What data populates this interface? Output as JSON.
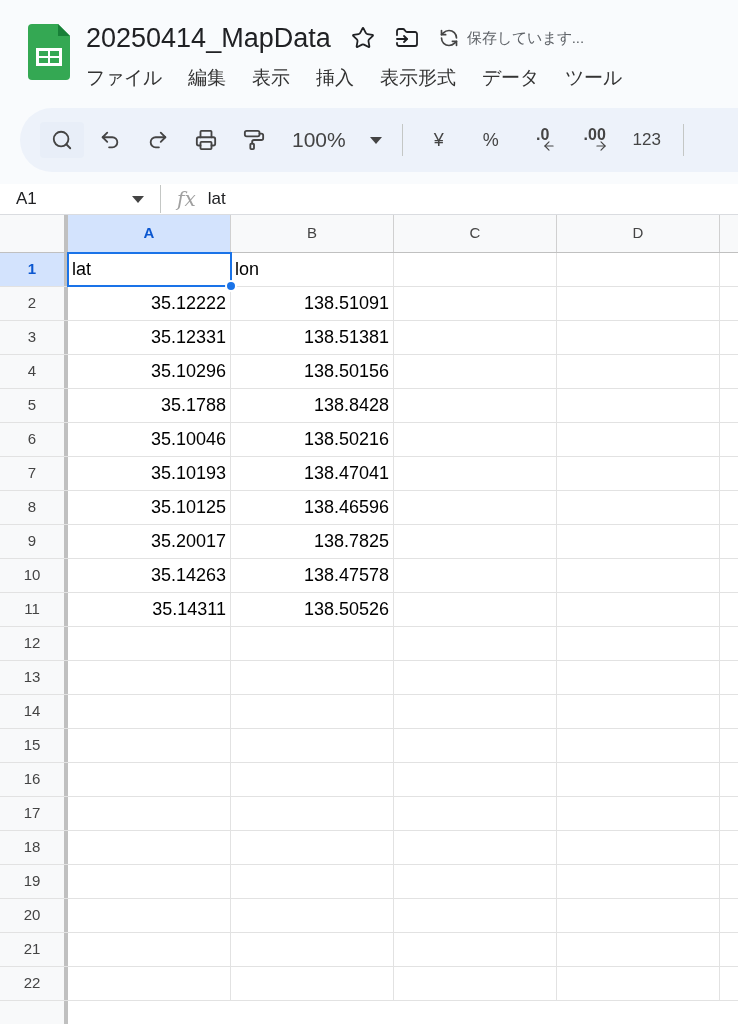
{
  "document": {
    "title": "20250414_MapData",
    "save_status": "保存しています..."
  },
  "menu": [
    {
      "label": "ファイル"
    },
    {
      "label": "編集"
    },
    {
      "label": "表示"
    },
    {
      "label": "挿入"
    },
    {
      "label": "表示形式"
    },
    {
      "label": "データ"
    },
    {
      "label": "ツール"
    }
  ],
  "toolbar": {
    "zoom": "100%",
    "currency": "¥",
    "percent": "%",
    "decrease_decimal": ".0",
    "increase_decimal": ".00",
    "number_format": "123"
  },
  "formula_bar": {
    "cell_ref": "A1",
    "fx_label": "fx",
    "value": "lat"
  },
  "sheet": {
    "columns": [
      {
        "label": "A",
        "selected": true
      },
      {
        "label": "B",
        "selected": false
      },
      {
        "label": "C",
        "selected": false
      },
      {
        "label": "D",
        "selected": false
      }
    ],
    "rows": [
      {
        "label": "1",
        "selected": true,
        "cells": [
          "lat",
          "lon"
        ],
        "kind": "text"
      },
      {
        "label": "2",
        "selected": false,
        "cells": [
          "35.12222",
          "138.51091"
        ],
        "kind": "number"
      },
      {
        "label": "3",
        "selected": false,
        "cells": [
          "35.12331",
          "138.51381"
        ],
        "kind": "number"
      },
      {
        "label": "4",
        "selected": false,
        "cells": [
          "35.10296",
          "138.50156"
        ],
        "kind": "number"
      },
      {
        "label": "5",
        "selected": false,
        "cells": [
          "35.1788",
          "138.8428"
        ],
        "kind": "number"
      },
      {
        "label": "6",
        "selected": false,
        "cells": [
          "35.10046",
          "138.50216"
        ],
        "kind": "number"
      },
      {
        "label": "7",
        "selected": false,
        "cells": [
          "35.10193",
          "138.47041"
        ],
        "kind": "number"
      },
      {
        "label": "8",
        "selected": false,
        "cells": [
          "35.10125",
          "138.46596"
        ],
        "kind": "number"
      },
      {
        "label": "9",
        "selected": false,
        "cells": [
          "35.20017",
          "138.7825"
        ],
        "kind": "number"
      },
      {
        "label": "10",
        "selected": false,
        "cells": [
          "35.14263",
          "138.47578"
        ],
        "kind": "number"
      },
      {
        "label": "11",
        "selected": false,
        "cells": [
          "35.14311",
          "138.50526"
        ],
        "kind": "number"
      },
      {
        "label": "12",
        "selected": false,
        "cells": [],
        "kind": "number"
      },
      {
        "label": "13",
        "selected": false,
        "cells": [],
        "kind": "number"
      },
      {
        "label": "14",
        "selected": false,
        "cells": [],
        "kind": "number"
      },
      {
        "label": "15",
        "selected": false,
        "cells": [],
        "kind": "number"
      },
      {
        "label": "16",
        "selected": false,
        "cells": [],
        "kind": "number"
      },
      {
        "label": "17",
        "selected": false,
        "cells": [],
        "kind": "number"
      },
      {
        "label": "18",
        "selected": false,
        "cells": [],
        "kind": "number"
      },
      {
        "label": "19",
        "selected": false,
        "cells": [],
        "kind": "number"
      },
      {
        "label": "20",
        "selected": false,
        "cells": [],
        "kind": "number"
      },
      {
        "label": "21",
        "selected": false,
        "cells": [],
        "kind": "number"
      },
      {
        "label": "22",
        "selected": false,
        "cells": [],
        "kind": "number"
      }
    ]
  }
}
